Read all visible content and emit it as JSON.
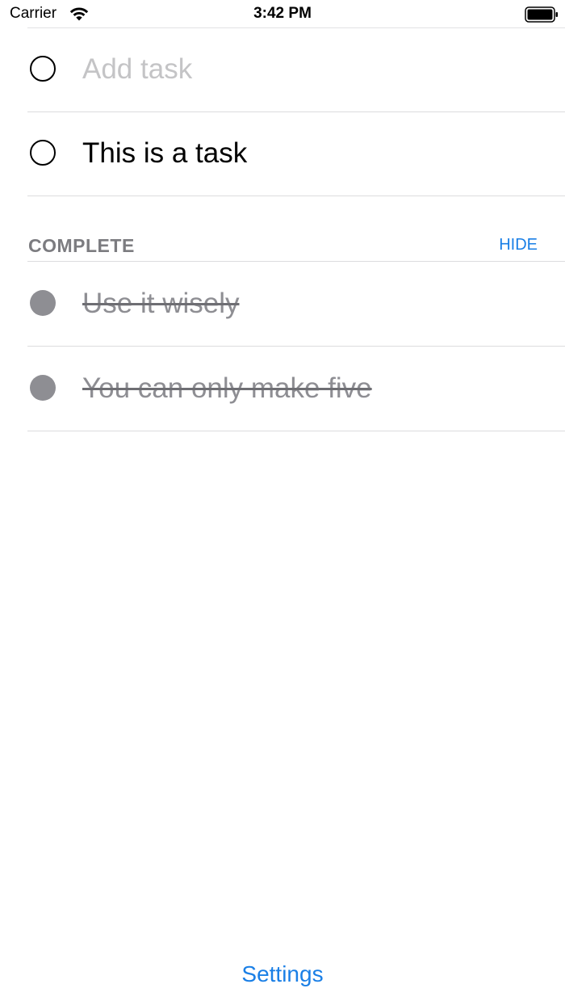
{
  "status_bar": {
    "carrier": "Carrier",
    "time": "3:42 PM",
    "wifi_icon": "wifi-icon",
    "battery_icon": "battery-icon"
  },
  "tasks": {
    "add_placeholder": "Add task",
    "items": [
      {
        "label": "This is a task",
        "complete": false
      }
    ]
  },
  "complete_section": {
    "title": "COMPLETE",
    "hide_label": "HIDE",
    "items": [
      {
        "label": "Use it wisely",
        "complete": true
      },
      {
        "label": "You can only make five",
        "complete": true
      }
    ]
  },
  "footer": {
    "settings_label": "Settings"
  },
  "colors": {
    "accent": "#1a7fe6",
    "completed_gray": "#8e8e93",
    "placeholder_gray": "#c4c4c6",
    "divider": "#dcdcde"
  }
}
